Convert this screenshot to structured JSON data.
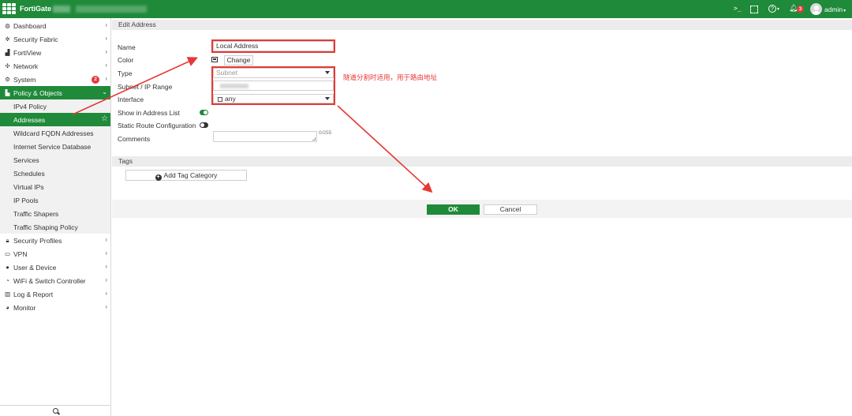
{
  "topbar": {
    "brand": "FortiGate",
    "user": "admin",
    "notif_count": "3",
    "icons": [
      "cli-icon",
      "fullscreen-icon",
      "help-icon",
      "bell-icon",
      "user-avatar-icon"
    ]
  },
  "sidebar": {
    "items": [
      {
        "label": "Dashboard",
        "icon": "dashboard-icon"
      },
      {
        "label": "Security Fabric",
        "icon": "security-fabric-icon"
      },
      {
        "label": "FortiView",
        "icon": "fortiview-icon"
      },
      {
        "label": "Network",
        "icon": "network-icon"
      },
      {
        "label": "System",
        "icon": "gear-icon",
        "badge": "2"
      },
      {
        "label": "Policy & Objects",
        "icon": "policy-icon"
      },
      {
        "label": "IPv4 Policy"
      },
      {
        "label": "Addresses"
      },
      {
        "label": "Wildcard FQDN Addresses"
      },
      {
        "label": "Internet Service Database"
      },
      {
        "label": "Services"
      },
      {
        "label": "Schedules"
      },
      {
        "label": "Virtual IPs"
      },
      {
        "label": "IP Pools"
      },
      {
        "label": "Traffic Shapers"
      },
      {
        "label": "Traffic Shaping Policy"
      },
      {
        "label": "Security Profiles",
        "icon": "lock-icon"
      },
      {
        "label": "VPN",
        "icon": "vpn-icon"
      },
      {
        "label": "User & Device",
        "icon": "user-icon"
      },
      {
        "label": "WiFi & Switch Controller",
        "icon": "wifi-icon"
      },
      {
        "label": "Log & Report",
        "icon": "chart-icon"
      },
      {
        "label": "Monitor",
        "icon": "monitor-icon"
      }
    ]
  },
  "form": {
    "section_title": "Edit Address",
    "labels": {
      "name": "Name",
      "color": "Color",
      "type": "Type",
      "subnet": "Subnet / IP Range",
      "interface": "Interface",
      "show_in_list": "Show in Address List",
      "static_route": "Static Route Configuration",
      "comments": "Comments"
    },
    "name_value": "Local Address",
    "change_label": "Change",
    "type_value": "Subnet",
    "interface_value": "any",
    "show_in_list": true,
    "static_route": false,
    "comments_counter": "0/255"
  },
  "tags": {
    "section_title": "Tags",
    "add_label": "Add Tag Category"
  },
  "actions": {
    "ok": "OK",
    "cancel": "Cancel"
  },
  "annotation": {
    "text": "隧道分割时适用，用于路由地址",
    "color": "#e53935"
  },
  "colors": {
    "brand_green": "#1f8a3a",
    "badge_red": "#e8383d"
  }
}
